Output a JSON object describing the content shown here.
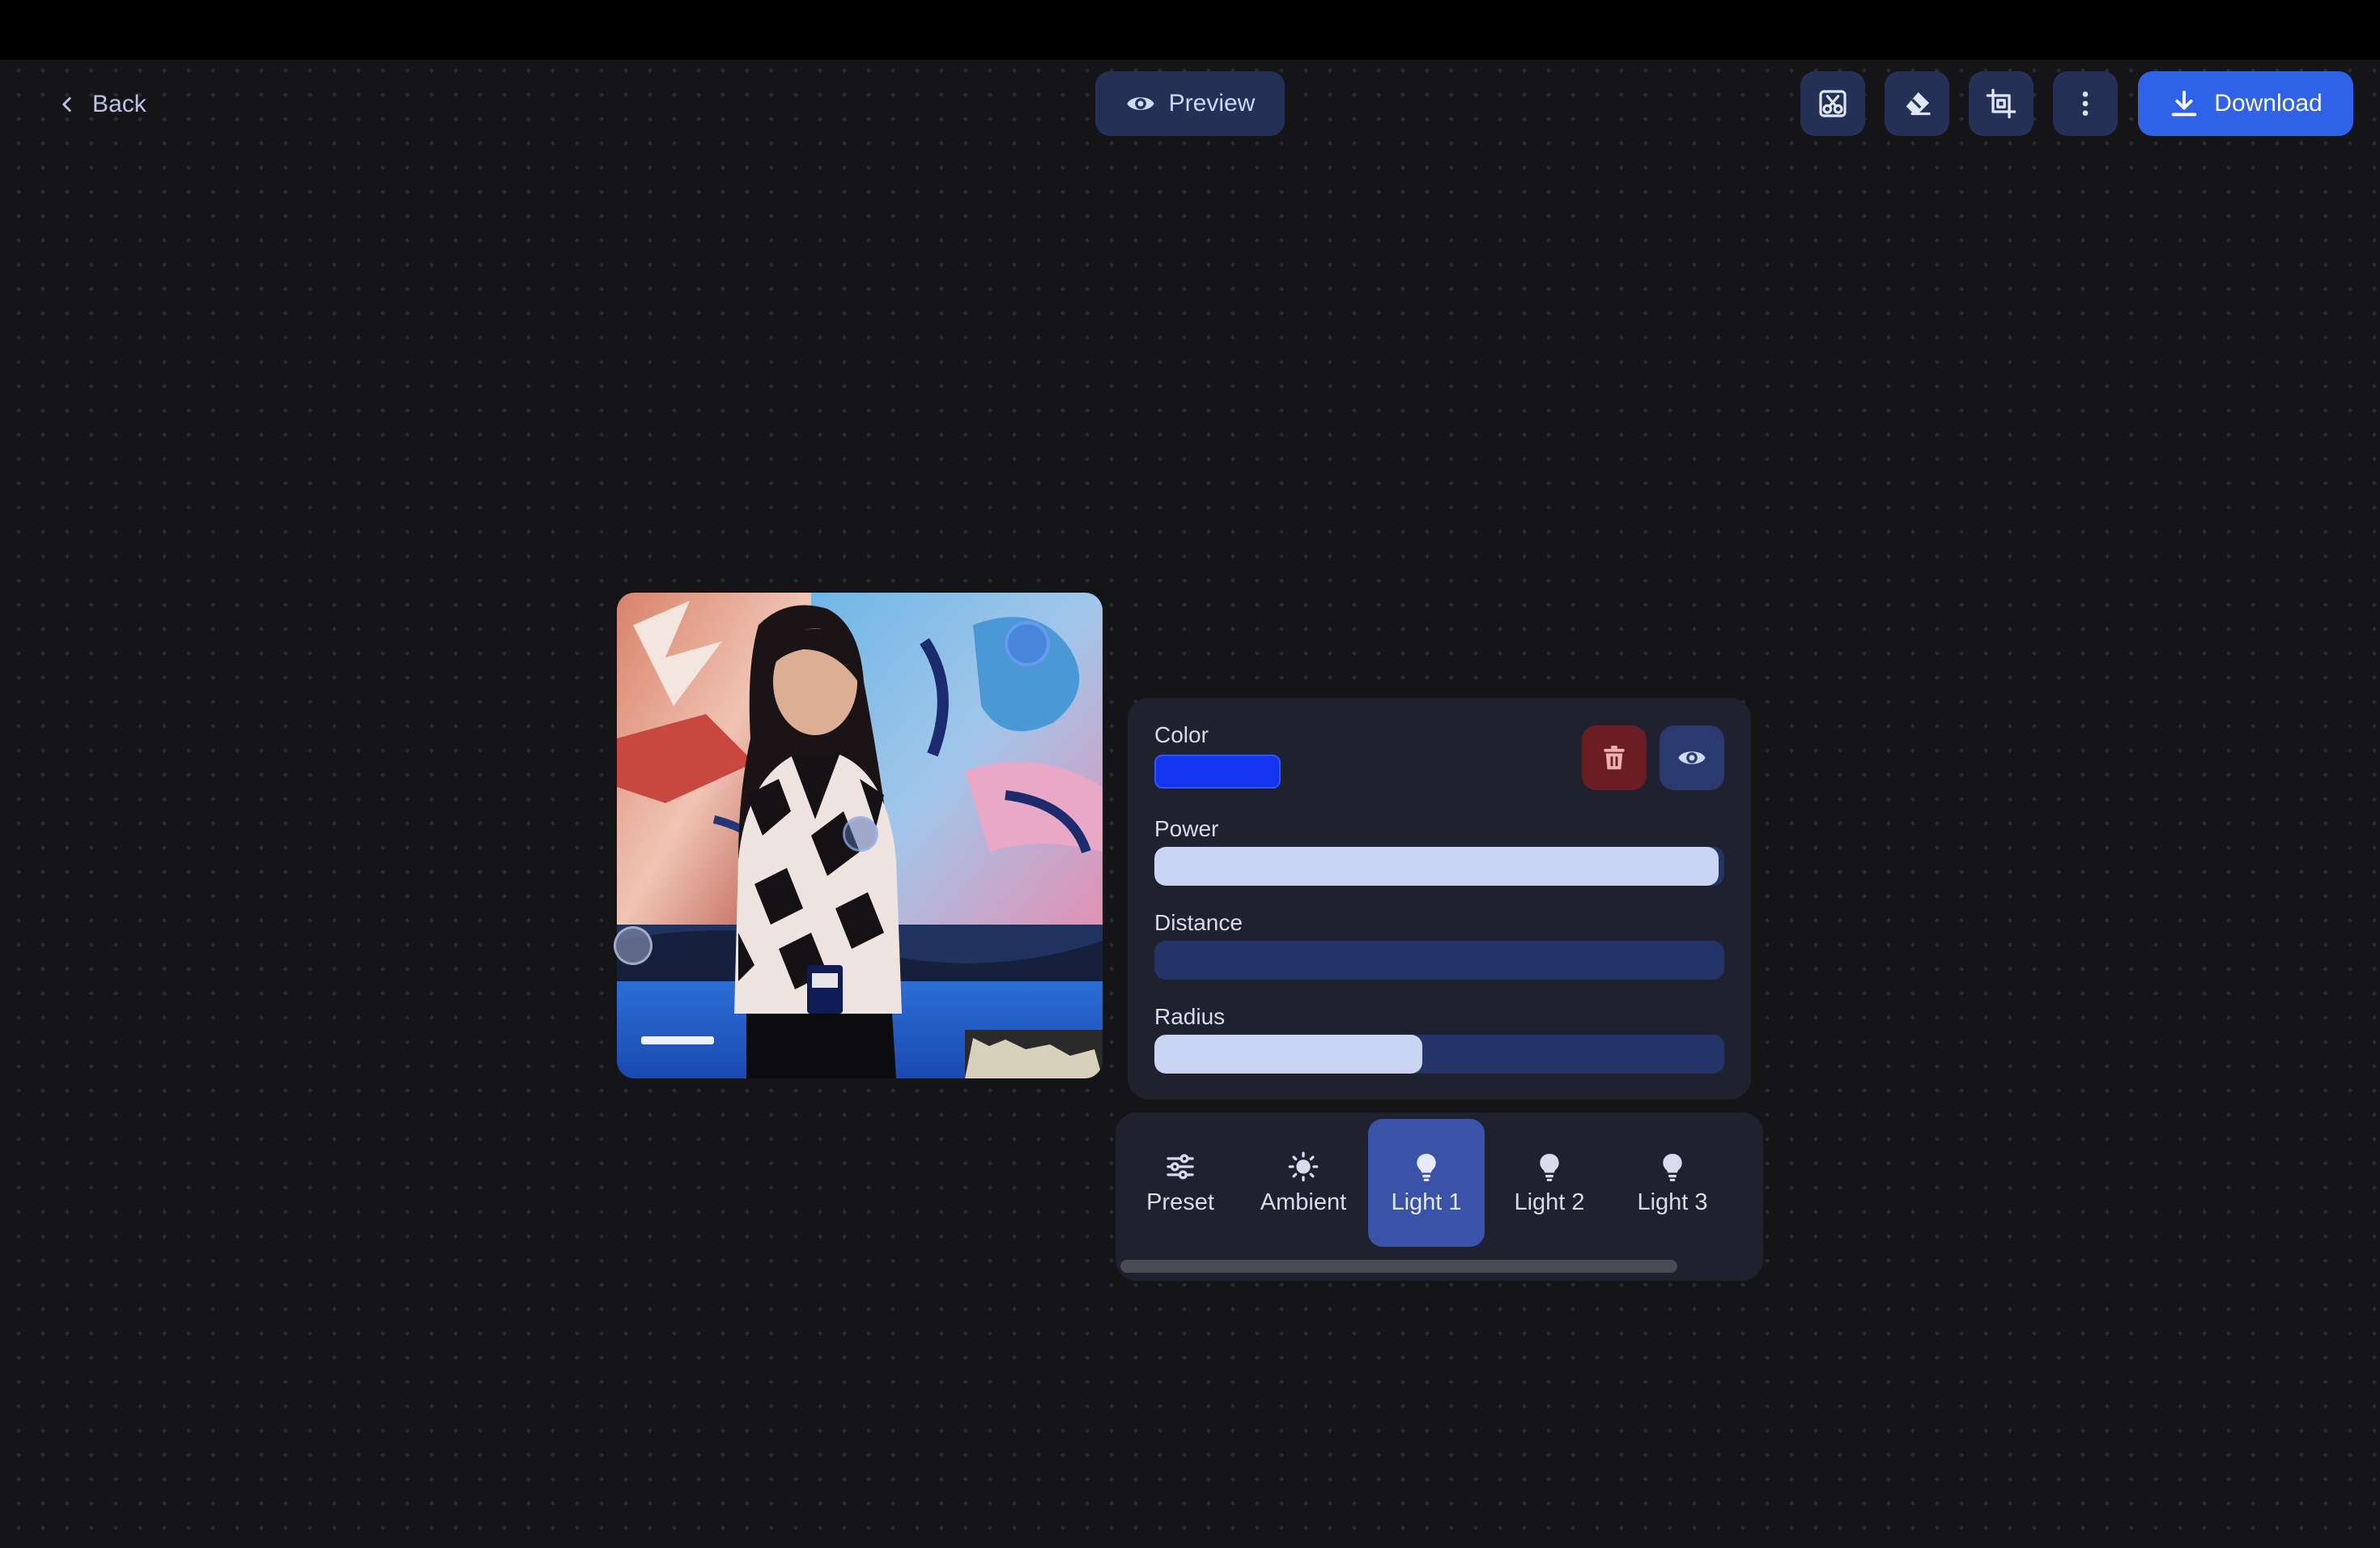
{
  "header": {
    "back_label": "Back",
    "preview_label": "Preview",
    "download_label": "Download",
    "tools": [
      "background-remove-icon",
      "eraser-icon",
      "crop-icon",
      "more-vertical-icon"
    ]
  },
  "light_panel": {
    "color_label": "Color",
    "color_value": "#1435f0",
    "power_label": "Power",
    "power_value": 0.99,
    "distance_label": "Distance",
    "distance_value": 0,
    "radius_label": "Radius",
    "radius_value": 0.47
  },
  "tabs": [
    {
      "label": "Preset",
      "icon": "sliders-icon",
      "active": false
    },
    {
      "label": "Ambient",
      "icon": "sun-icon",
      "active": false
    },
    {
      "label": "Light 1",
      "icon": "bulb-icon",
      "active": true
    },
    {
      "label": "Light 2",
      "icon": "bulb-icon",
      "active": false
    },
    {
      "label": "Light 3",
      "icon": "bulb-icon",
      "active": false
    }
  ],
  "colors": {
    "accent": "#2e62e8",
    "button_bg": "#253056",
    "panel_bg": "#1f222e",
    "active_tab": "#3a52a8",
    "danger_bg": "#6a1e22",
    "slider_track": "#243468",
    "slider_fill": "#c8d4f2"
  }
}
